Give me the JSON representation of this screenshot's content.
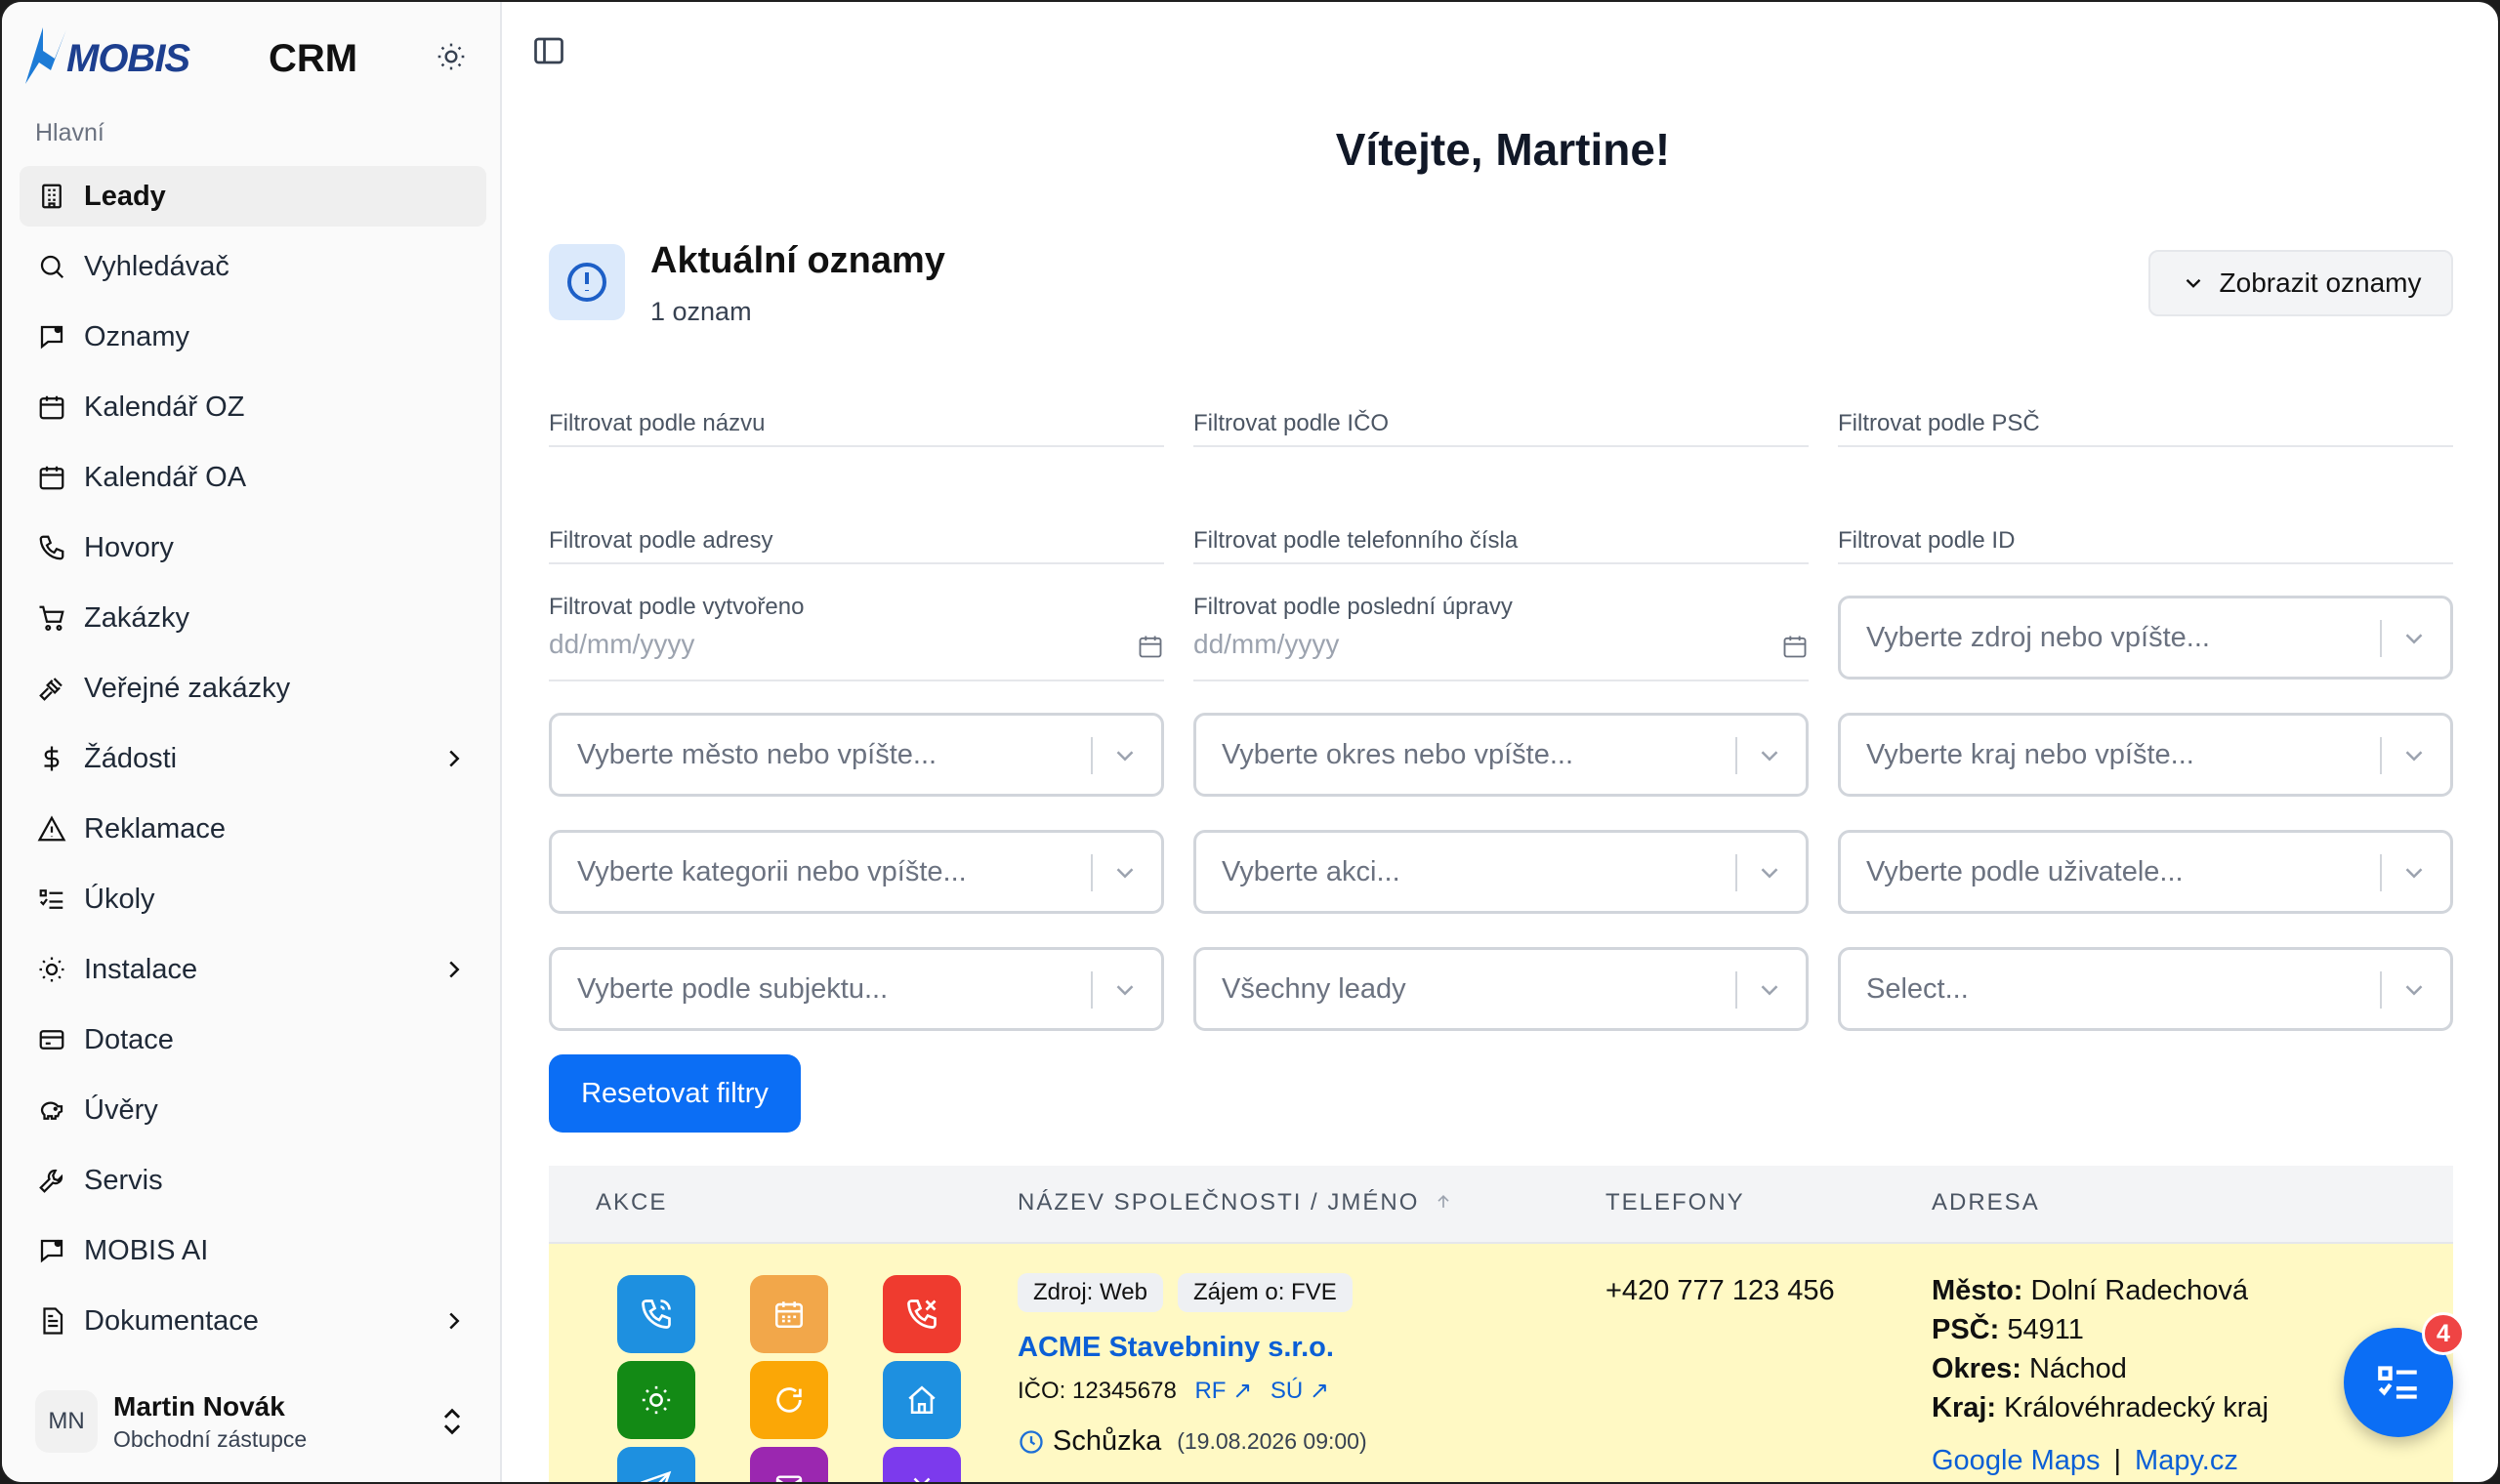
{
  "app": {
    "logo_text": "MOBIS",
    "title": "CRM"
  },
  "sidebar": {
    "section": "Hlavní",
    "items": [
      {
        "label": "Leady",
        "icon": "building-icon",
        "active": true
      },
      {
        "label": "Vyhledávač",
        "icon": "search-icon"
      },
      {
        "label": "Oznamy",
        "icon": "message-icon"
      },
      {
        "label": "Kalendář OZ",
        "icon": "calendar-icon"
      },
      {
        "label": "Kalendář OA",
        "icon": "calendar-icon"
      },
      {
        "label": "Hovory",
        "icon": "phone-icon"
      },
      {
        "label": "Zakázky",
        "icon": "cart-icon"
      },
      {
        "label": "Veřejné zakázky",
        "icon": "gavel-icon"
      },
      {
        "label": "Žádosti",
        "icon": "dollar-icon",
        "expandable": true
      },
      {
        "label": "Reklamace",
        "icon": "warning-icon"
      },
      {
        "label": "Úkoly",
        "icon": "tasks-icon"
      },
      {
        "label": "Instalace",
        "icon": "sun-icon",
        "expandable": true
      },
      {
        "label": "Dotace",
        "icon": "ticket-icon"
      },
      {
        "label": "Úvěry",
        "icon": "piggy-icon"
      },
      {
        "label": "Servis",
        "icon": "wrench-icon"
      },
      {
        "label": "MOBIS AI",
        "icon": "message-icon"
      },
      {
        "label": "Dokumentace",
        "icon": "document-icon",
        "expandable": true
      }
    ],
    "user": {
      "initials": "MN",
      "name": "Martin Novák",
      "role": "Obchodní zástupce"
    }
  },
  "main": {
    "welcome": "Vítejte, Martine!",
    "announcements": {
      "title": "Aktuální oznamy",
      "count": "1 oznam",
      "button": "Zobrazit oznamy"
    },
    "filters": {
      "name": "Filtrovat podle názvu",
      "ico": "Filtrovat podle IČO",
      "psc": "Filtrovat podle PSČ",
      "address": "Filtrovat podle adresy",
      "phone": "Filtrovat podle telefonního čísla",
      "id": "Filtrovat podle ID",
      "created": "Filtrovat podle vytvořeno",
      "modified": "Filtrovat podle poslední úpravy",
      "date_placeholder": "dd/mm/yyyy",
      "source": "Vyberte zdroj nebo vpíšte...",
      "city": "Vyberte město nebo vpíšte...",
      "district": "Vyberte okres nebo vpíšte...",
      "region": "Vyberte kraj nebo vpíšte...",
      "category": "Vyberte kategorii nebo vpíšte...",
      "action": "Vyberte akci...",
      "user": "Vyberte podle uživatele...",
      "subject": "Vyberte podle subjektu...",
      "leads": "Všechny leady",
      "select": "Select..."
    },
    "reset_button": "Resetovat filtry",
    "table": {
      "headers": {
        "actions": "AKCE",
        "company": "NÁZEV SPOLEČNOSTI / JMÉNO",
        "phones": "TELEFONY",
        "address": "ADRESA"
      },
      "row": {
        "source_tag": "Zdroj: Web",
        "interest_tag": "Zájem o: FVE",
        "company": "ACME Stavebniny s.r.o.",
        "ico": "IČO: 12345678",
        "rf_link": "RF ↗",
        "su_link": "SÚ ↗",
        "meeting": "Schůzka",
        "meeting_date": "(19.08.2026 09:00)",
        "phone": "+420 777 123 456",
        "city_label": "Město:",
        "city": "Dolní Radechová",
        "psc_label": "PSČ:",
        "psc": "54911",
        "district_label": "Okres:",
        "district": "Náchod",
        "region_label": "Kraj:",
        "region": "Královéhradecký kraj",
        "google_maps": "Google Maps",
        "link_sep": "|",
        "mapy": "Mapy.cz"
      }
    },
    "fab_badge": "4"
  },
  "colors": {
    "primary": "#0b6ef5",
    "row_highlight": "#fff9c4",
    "brand": "#1d3f8f"
  }
}
